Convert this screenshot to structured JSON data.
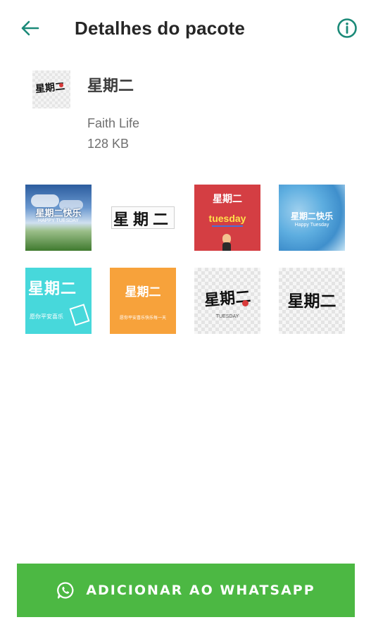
{
  "appbar": {
    "title": "Detalhes do pacote",
    "back_icon": "arrow-left-icon",
    "info_icon": "info-circle-icon",
    "accent_color": "#1b8a78"
  },
  "pack": {
    "name": "星期二",
    "tray_text": "星期二",
    "publisher": "Faith Life",
    "size": "128 KB"
  },
  "stickers": [
    {
      "id": "sticker-1",
      "text": "星期二快乐",
      "sub": "HAPPY TUESDAY",
      "style": "sky-grass"
    },
    {
      "id": "sticker-2",
      "text": "星期二",
      "sub": "",
      "style": "black-on-white"
    },
    {
      "id": "sticker-3",
      "text": "星期二",
      "sub": "tuesday",
      "style": "red-card"
    },
    {
      "id": "sticker-4",
      "text": "星期二快乐",
      "sub": "Happy Tuesday",
      "style": "blue-watercolor"
    },
    {
      "id": "sticker-5",
      "text": "星期二",
      "sub": "愿你平安喜乐",
      "style": "cyan-card"
    },
    {
      "id": "sticker-6",
      "text": "星期二",
      "sub": "愿你平安喜乐快乐每一天",
      "style": "orange-card"
    },
    {
      "id": "sticker-7",
      "text": "星期二",
      "sub": "TUESDAY",
      "style": "calligraphy-red"
    },
    {
      "id": "sticker-8",
      "text": "星期二",
      "sub": "",
      "style": "calligraphy-black"
    }
  ],
  "add_button": {
    "label": "ADICIONAR AO WHATSAPP",
    "icon": "whatsapp-icon",
    "color": "#4cb843"
  }
}
